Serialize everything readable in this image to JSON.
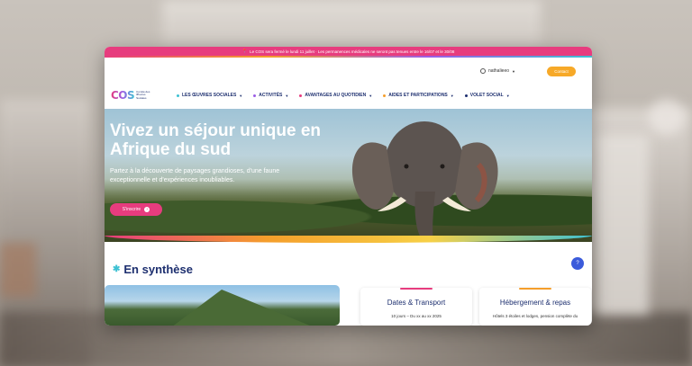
{
  "announcement": {
    "icon": "pin-icon",
    "text": "Le COS sera fermé le lundi 11 juillet · Les permanences médicales ne seront pas tenues entre le 16/07 et le 30/08"
  },
  "header": {
    "user_label": "nathalieeo",
    "contact_label": "Contact"
  },
  "logo": {
    "mark": "COS",
    "subtitle": "Comité des Œuvres Sociales"
  },
  "nav": {
    "items": [
      {
        "label": "LES ŒUVRES SOCIALES",
        "color": "#3ec1d3"
      },
      {
        "label": "ACTIVITÉS",
        "color": "#9b5de5"
      },
      {
        "label": "AVANTAGES AU QUOTIDIEN",
        "color": "#e73c7e"
      },
      {
        "label": "AIDES ET PARTICIPATIONS",
        "color": "#f59e2b"
      },
      {
        "label": "VOLET SOCIAL",
        "color": "#1d2f6f"
      }
    ]
  },
  "hero": {
    "title": "Vivez un séjour unique en Afrique du sud",
    "subtitle": "Partez à la découverte de paysages grandioses, d'une faune exceptionnelle et d'expériences inoubliables.",
    "button_label": "S'inscrire"
  },
  "synthese": {
    "title": "En synthèse",
    "help_label": "?",
    "cards": [
      {
        "title": "Dates & Transport",
        "text": "10 jours – Du xx au xx 2025",
        "color": "#e73c7e"
      },
      {
        "title": "Hébergement & repas",
        "text": "Hôtels 3 étoiles et lodges, pension complète du",
        "color": "#f59e2b"
      }
    ]
  }
}
